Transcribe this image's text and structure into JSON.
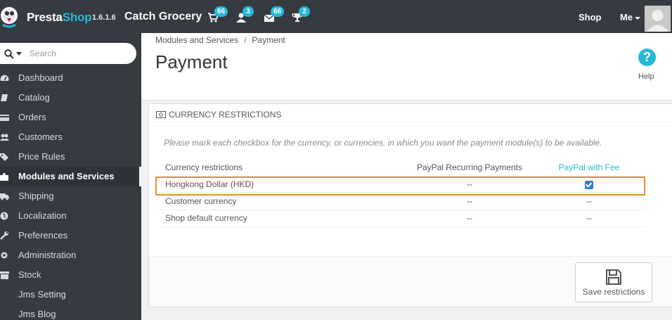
{
  "topbar": {
    "brand_presta": "Presta",
    "brand_shop": "Shop",
    "version": "1.6.1.6",
    "store_name": "Catch Grocery",
    "notifications": [
      {
        "icon": "cart-icon",
        "count": "66"
      },
      {
        "icon": "user-icon",
        "count": "3"
      },
      {
        "icon": "envelope-icon",
        "count": "66"
      },
      {
        "icon": "trophy-icon",
        "count": "2"
      }
    ],
    "shop_link": "Shop",
    "me_link": "Me"
  },
  "sidebar": {
    "search_placeholder": "Search",
    "items": [
      {
        "label": "Dashboard",
        "icon": "dashboard-icon"
      },
      {
        "label": "Catalog",
        "icon": "book-icon"
      },
      {
        "label": "Orders",
        "icon": "credit-card-icon"
      },
      {
        "label": "Customers",
        "icon": "users-icon"
      },
      {
        "label": "Price Rules",
        "icon": "tags-icon"
      },
      {
        "label": "Modules and Services",
        "icon": "puzzle-icon",
        "active": true
      },
      {
        "label": "Shipping",
        "icon": "truck-icon"
      },
      {
        "label": "Localization",
        "icon": "globe-icon"
      },
      {
        "label": "Preferences",
        "icon": "wrench-icon"
      },
      {
        "label": "Administration",
        "icon": "cogs-icon"
      },
      {
        "label": "Stock",
        "icon": "archive-icon"
      },
      {
        "label": "Jms Setting",
        "icon": ""
      },
      {
        "label": "Jms Blog",
        "icon": ""
      }
    ]
  },
  "header": {
    "breadcrumb": [
      "Modules and Services",
      "Payment"
    ],
    "breadcrumb_sep": "/",
    "title": "Payment",
    "help_label": "Help",
    "help_icon": "?"
  },
  "panel": {
    "title": "CURRENCY RESTRICTIONS",
    "help_text": "Please mark each checkbox for the currency, or currencies, in which you want the payment module(s) to be available.",
    "columns": [
      "Currency restrictions",
      "PayPal Recurring Payments",
      "PayPal with Fee"
    ],
    "rows": [
      {
        "name": "Hongkong Dollar (HKD)",
        "col2": "--",
        "col3_checked": true
      },
      {
        "name": "Customer currency",
        "col2": "--",
        "col3": "--"
      },
      {
        "name": "Shop default currency",
        "col2": "--",
        "col3": "--"
      }
    ],
    "save_label": "Save restrictions"
  },
  "colors": {
    "topbar": "#363a41",
    "accent": "#25b9d7",
    "highlight": "#ef8b2c",
    "checkbox": "#2f7fd8"
  }
}
